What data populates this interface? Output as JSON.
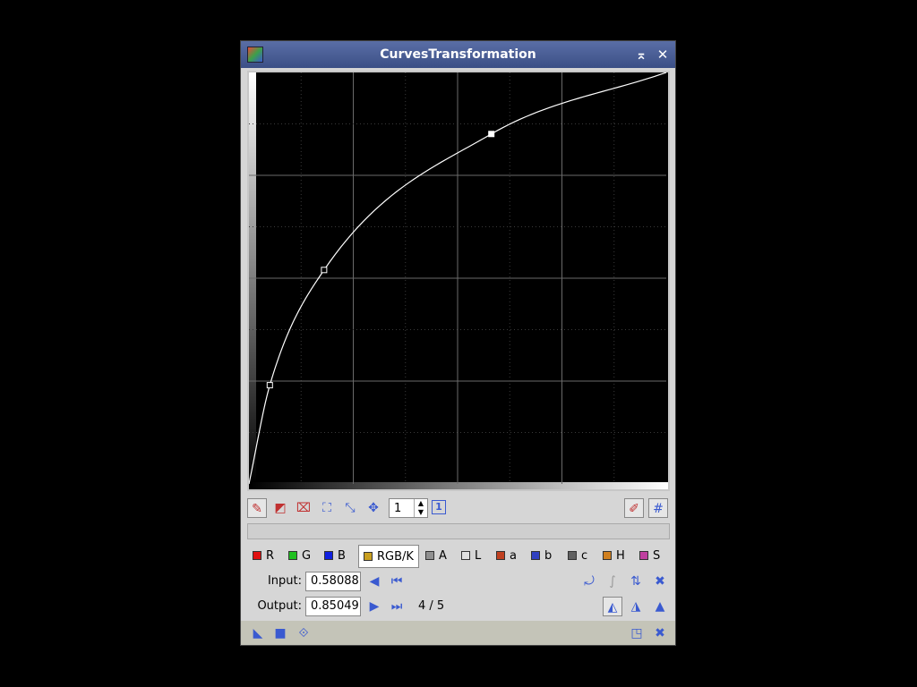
{
  "window": {
    "title": "CurvesTransformation",
    "collapse_icon": "⌅",
    "close_icon": "✕"
  },
  "curve": {
    "points": [
      [
        0,
        0
      ],
      [
        0.05,
        0.24
      ],
      [
        0.18,
        0.52
      ],
      [
        0.58088,
        0.85049
      ],
      [
        1,
        1
      ]
    ],
    "selected_index": 3
  },
  "toolbar": {
    "zoom_value": "1",
    "zoom_reset_icon": "1"
  },
  "channels": [
    {
      "label": "R",
      "color": "#e01010"
    },
    {
      "label": "G",
      "color": "#20c020"
    },
    {
      "label": "B",
      "color": "#1020e0"
    },
    {
      "label": "RGB/K",
      "color": "#caa020"
    },
    {
      "label": "A",
      "color": "#909090"
    },
    {
      "label": "L",
      "color": "#e0e0e0"
    },
    {
      "label": "a",
      "color": "#c04020"
    },
    {
      "label": "b",
      "color": "#3040c0"
    },
    {
      "label": "c",
      "color": "#606060"
    },
    {
      "label": "H",
      "color": "#d08020"
    },
    {
      "label": "S",
      "color": "#c040a0"
    }
  ],
  "input": {
    "label": "Input:",
    "value": "0.58088"
  },
  "output": {
    "label": "Output:",
    "value": "0.85049"
  },
  "point_counter": "4 / 5",
  "colors": {
    "accent": "#3a5ad0",
    "title_bar": "#4a5e96"
  }
}
